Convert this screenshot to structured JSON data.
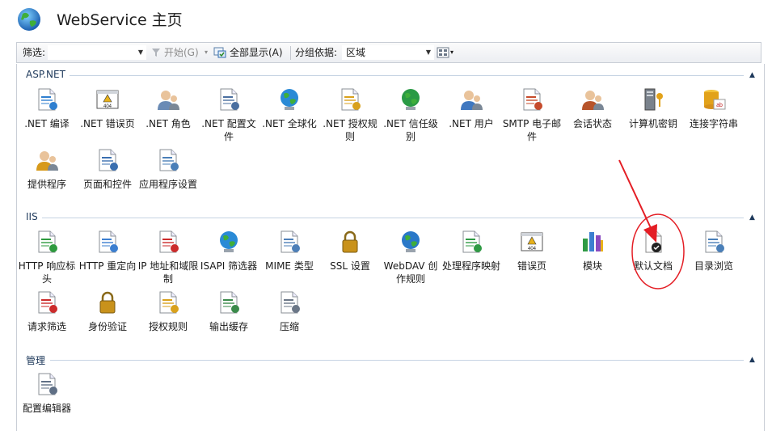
{
  "header": {
    "title": "WebService 主页"
  },
  "toolbar": {
    "filter_label": "筛选:",
    "filter_value": "",
    "start_label": "开始(G)",
    "show_all_label": "全部显示(A)",
    "group_by_label": "分组依据:",
    "group_by_value": "区域"
  },
  "groups": {
    "aspnet": {
      "label": "ASP.NET",
      "items": [
        {
          "label": ".NET 编译",
          "icon": "compile-icon"
        },
        {
          "label": ".NET 错误页",
          "icon": "error-page-icon"
        },
        {
          "label": ".NET 角色",
          "icon": "roles-icon"
        },
        {
          "label": ".NET 配置文件",
          "icon": "profile-icon"
        },
        {
          "label": ".NET 全球化",
          "icon": "globalization-icon"
        },
        {
          "label": ".NET 授权规则",
          "icon": "authorization-icon"
        },
        {
          "label": ".NET 信任级别",
          "icon": "trust-level-icon"
        },
        {
          "label": ".NET 用户",
          "icon": "users-icon"
        },
        {
          "label": "SMTP 电子邮件",
          "icon": "smtp-email-icon"
        },
        {
          "label": "会话状态",
          "icon": "session-state-icon"
        },
        {
          "label": "计算机密钥",
          "icon": "machine-key-icon"
        },
        {
          "label": "连接字符串",
          "icon": "connection-string-icon"
        },
        {
          "label": "提供程序",
          "icon": "providers-icon"
        },
        {
          "label": "页面和控件",
          "icon": "pages-controls-icon"
        },
        {
          "label": "应用程序设置",
          "icon": "app-settings-icon"
        }
      ]
    },
    "iis": {
      "label": "IIS",
      "items": [
        {
          "label": "HTTP 响应标头",
          "icon": "http-headers-icon"
        },
        {
          "label": "HTTP 重定向",
          "icon": "http-redirect-icon"
        },
        {
          "label": "IP 地址和域限制",
          "icon": "ip-restrictions-icon"
        },
        {
          "label": "ISAPI 筛选器",
          "icon": "isapi-filters-icon"
        },
        {
          "label": "MIME 类型",
          "icon": "mime-types-icon"
        },
        {
          "label": "SSL 设置",
          "icon": "ssl-lock-icon"
        },
        {
          "label": "WebDAV 创作规则",
          "icon": "webdav-icon"
        },
        {
          "label": "处理程序映射",
          "icon": "handler-mappings-icon"
        },
        {
          "label": "错误页",
          "icon": "error-pages-icon"
        },
        {
          "label": "模块",
          "icon": "modules-icon"
        },
        {
          "label": "默认文档",
          "icon": "default-document-icon"
        },
        {
          "label": "目录浏览",
          "icon": "directory-browsing-icon"
        },
        {
          "label": "请求筛选",
          "icon": "request-filtering-icon"
        },
        {
          "label": "身份验证",
          "icon": "authentication-icon"
        },
        {
          "label": "授权规则",
          "icon": "authorization-rules-icon"
        },
        {
          "label": "输出缓存",
          "icon": "output-caching-icon"
        },
        {
          "label": "压缩",
          "icon": "compression-icon"
        }
      ]
    },
    "management": {
      "label": "管理",
      "items": [
        {
          "label": "配置编辑器",
          "icon": "config-editor-icon"
        }
      ]
    }
  }
}
